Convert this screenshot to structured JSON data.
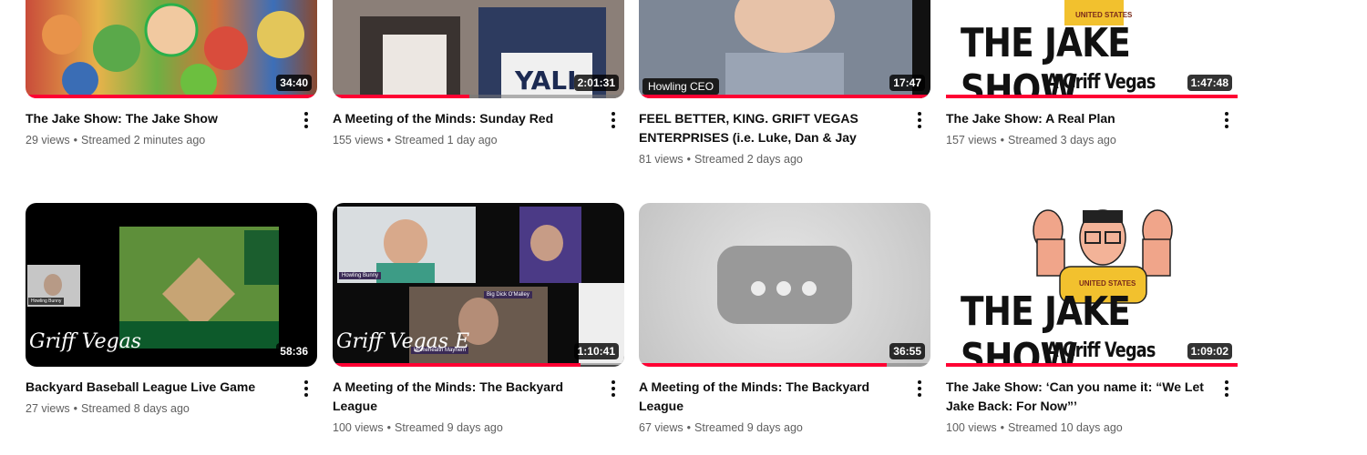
{
  "colors": {
    "accent": "#ff0033",
    "meta_text": "#606060",
    "title_text": "#0f0f0f"
  },
  "icons": {
    "more": "three-dots-vertical-icon",
    "loading": "ellipsis-icon"
  },
  "videos": [
    {
      "title": "The Jake Show: The Jake Show",
      "views": "29 views",
      "streamed": "Streamed 2 minutes ago",
      "duration": "34:40",
      "progress": 1.0
    },
    {
      "title": "A Meeting of the Minds: Sunday Red",
      "views": "155 views",
      "streamed": "Streamed 1 day ago",
      "duration": "2:01:31",
      "progress": 0.47
    },
    {
      "title": "FEEL BETTER, KING. GRIFT VEGAS ENTERPRISES (i.e. Luke, Dan & Jay",
      "views": "81 views",
      "streamed": "Streamed 2 days ago",
      "duration": "17:47",
      "progress": 1.0,
      "overlay_label": "Howling CEO"
    },
    {
      "title": "The Jake Show: A Real Plan",
      "views": "157 views",
      "streamed": "Streamed 3 days ago",
      "duration": "1:47:48",
      "progress": 1.0,
      "thumb_text_1": "THE JAKE SHOW",
      "thumb_text_2": "A Griff Vegas Production",
      "shirt_text": "UNITED STATES"
    },
    {
      "title": "Backyard Baseball League Live Game",
      "views": "27 views",
      "streamed": "Streamed 8 days ago",
      "duration": "58:36",
      "progress": 0,
      "watermark": "Griff Vegas",
      "cam_label": "Howling Bunny"
    },
    {
      "title": "A Meeting of the Minds: The Backyard League",
      "views": "100 views",
      "streamed": "Streamed 9 days ago",
      "duration": "1:10:41",
      "progress": 0.85,
      "cam_1": "Howling Bunny",
      "cam_2": "Big Dick O'Malley",
      "cam_3": "Homehealth Mayhem",
      "watermark": "Griff Vegas E"
    },
    {
      "title": "A Meeting of the Minds: The Backyard League",
      "views": "67 views",
      "streamed": "Streamed 9 days ago",
      "duration": "36:55",
      "progress": 0.85
    },
    {
      "title": "The Jake Show: ‘Can you name it: “We Let Jake Back: For Now”’",
      "views": "100 views",
      "streamed": "Streamed 10 days ago",
      "duration": "1:09:02",
      "progress": 1.0,
      "thumb_text_1": "THE JAKE SHOW",
      "thumb_text_2": "A Griff Vegas Production",
      "shirt_text": "UNITED STATES"
    }
  ]
}
